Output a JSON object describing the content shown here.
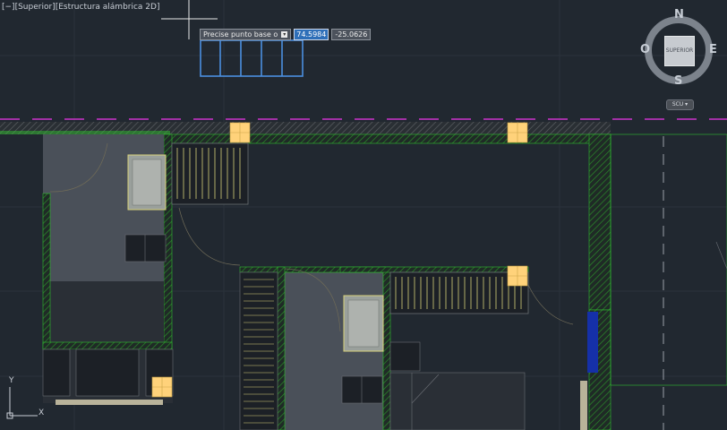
{
  "viewport_label": {
    "minus": "[−]",
    "view": "[Superior]",
    "style": "[Estructura alámbrica 2D]"
  },
  "dynamic_input": {
    "prompt": "Precise punto base o",
    "dropdown_icon": "chevron-down-icon",
    "x_value": "74.5984",
    "y_value": "-25.0626"
  },
  "viewcube": {
    "north": "N",
    "south": "S",
    "east": "E",
    "west": "O",
    "face": "SUPERIOR",
    "wcs": "SCU"
  },
  "ucs": {
    "y_axis": "Y",
    "x_axis": "X"
  },
  "colors": {
    "background": "#212830",
    "room_fill": "#4a5059",
    "wall_hatch": "#1e5a1e",
    "wall_border": "#2fbf2f",
    "magenta_line": "#cc33cc",
    "column": "#ffd27a",
    "selection": "#4a8fe0",
    "door_blue": "#1530a8"
  }
}
